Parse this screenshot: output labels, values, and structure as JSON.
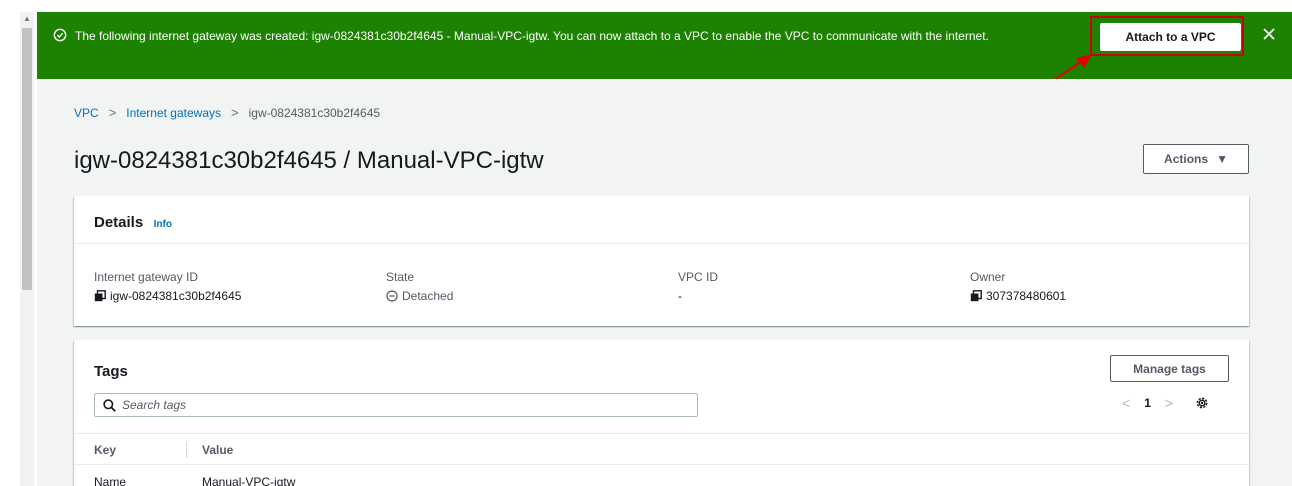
{
  "flash": {
    "message": "The following internet gateway was created: igw-0824381c30b2f4645 - Manual-VPC-igtw. You can now attach to a VPC to enable the VPC to communicate with the internet.",
    "attach_label": "Attach to a VPC",
    "background": "#1d8102"
  },
  "breadcrumb": {
    "items": [
      "VPC",
      "Internet gateways",
      "igw-0824381c30b2f4645"
    ]
  },
  "page": {
    "title": "igw-0824381c30b2f4645 / Manual-VPC-igtw",
    "actions_label": "Actions"
  },
  "details": {
    "title": "Details",
    "info_label": "Info",
    "fields": [
      {
        "label": "Internet gateway ID",
        "value": "igw-0824381c30b2f4645",
        "icon": "copy-icon"
      },
      {
        "label": "State",
        "value": "Detached",
        "icon": "detached-status-icon"
      },
      {
        "label": "VPC ID",
        "value": "-"
      },
      {
        "label": "Owner",
        "value": "307378480601",
        "icon": "copy-icon"
      }
    ]
  },
  "tags": {
    "title": "Tags",
    "manage_label": "Manage tags",
    "search_placeholder": "Search tags",
    "page_number": "1",
    "columns": [
      "Key",
      "Value"
    ],
    "rows": [
      {
        "key": "Name",
        "value": "Manual-VPC-igtw"
      }
    ]
  },
  "colors": {
    "link": "#0073bb",
    "success": "#1d8102",
    "annotation": "#d10000"
  }
}
